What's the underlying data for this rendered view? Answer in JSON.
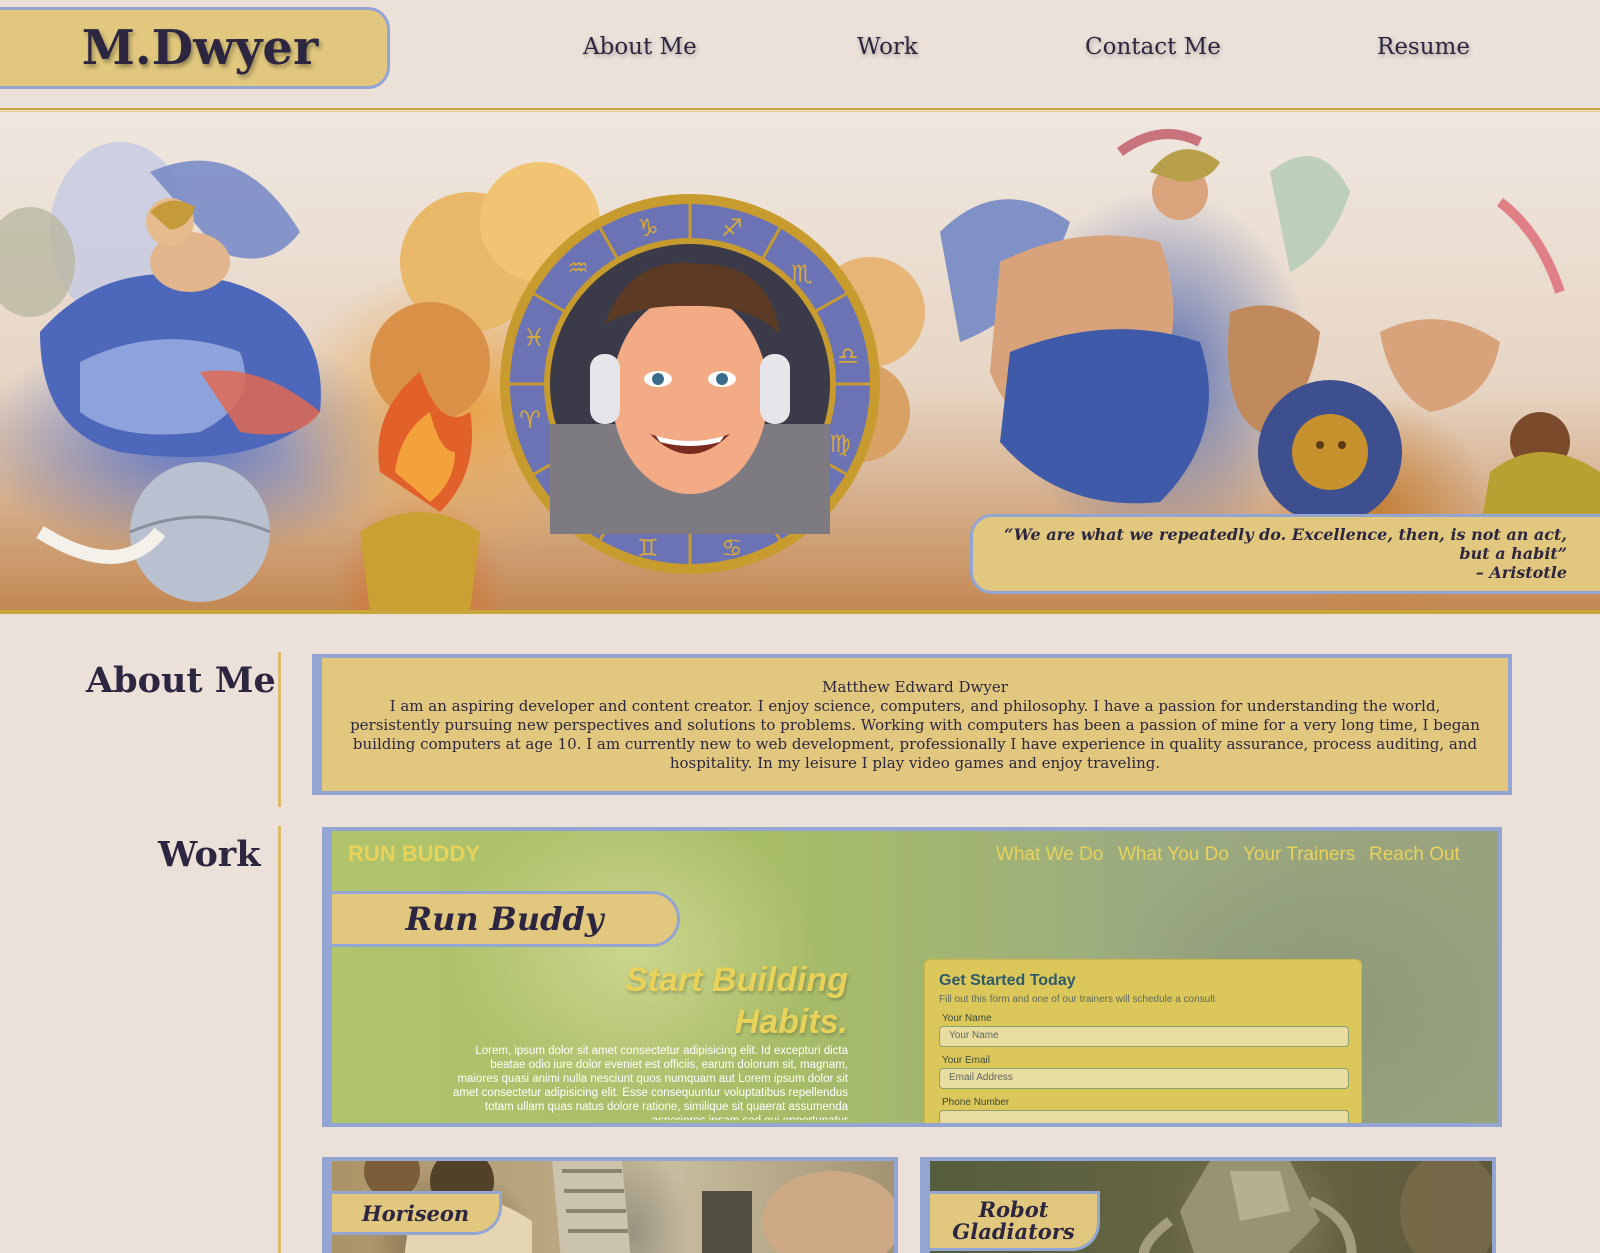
{
  "header": {
    "logo": "M.Dwyer",
    "nav": [
      {
        "label": "About Me"
      },
      {
        "label": "Work"
      },
      {
        "label": "Contact Me"
      },
      {
        "label": "Resume"
      }
    ]
  },
  "hero": {
    "quote": "“We are what we repeatedly do. Excellence, then, is not an act, but a habit”",
    "author": "– Aristotle"
  },
  "about": {
    "title": "About Me",
    "name": "Matthew Edward Dwyer",
    "bio": "I am an aspiring developer and content creator. I enjoy science, computers, and philosophy. I have a passion for understanding the world, persistently pursuing new perspectives and solutions to problems. Working with computers has been a passion of mine for a very long time, I began building computers at age 10. I am currently new to web development, professionally I have experience in quality assurance, process auditing, and hospitality. In my leisure I play video games and enjoy traveling."
  },
  "work": {
    "title": "Work",
    "projects": [
      {
        "label": "Run Buddy",
        "preview": {
          "brand": "RUN BUDDY",
          "nav": [
            "What We Do",
            "What You Do",
            "Your Trainers",
            "Reach Out"
          ],
          "headline_1": "Start Building",
          "headline_2": "Habits.",
          "lorem": "Lorem, ipsum dolor sit amet consectetur adipisicing elit. Id excepturi dicta beatae odio iure dolor eveniet est officiis, earum dolorum sit, magnam, maiores quasi animi nulla nesciunt quos numquam aut Lorem ipsum dolor sit amet consectetur adipisicing elit. Esse consequuntur voluptatibus repellendus totam ullam quas natus dolore ratione, similique sit quaerat assumenda asperiores ipsam sed qui opportunatur",
          "form": {
            "title": "Get Started Today",
            "subtitle": "Fill out this form and one of our trainers will schedule a consult",
            "name_label": "Your Name",
            "name_placeholder": "Your Name",
            "email_label": "Your Email",
            "email_placeholder": "Email Address",
            "phone_label": "Phone Number"
          }
        }
      },
      {
        "label": "Horiseon"
      },
      {
        "label_1": "Robot",
        "label_2": "Gladiators"
      }
    ]
  },
  "colors": {
    "background": "#ebe1d9",
    "gold": "#e1c87e",
    "border_blue": "#93a5d3",
    "text_dark": "#2c2640"
  }
}
